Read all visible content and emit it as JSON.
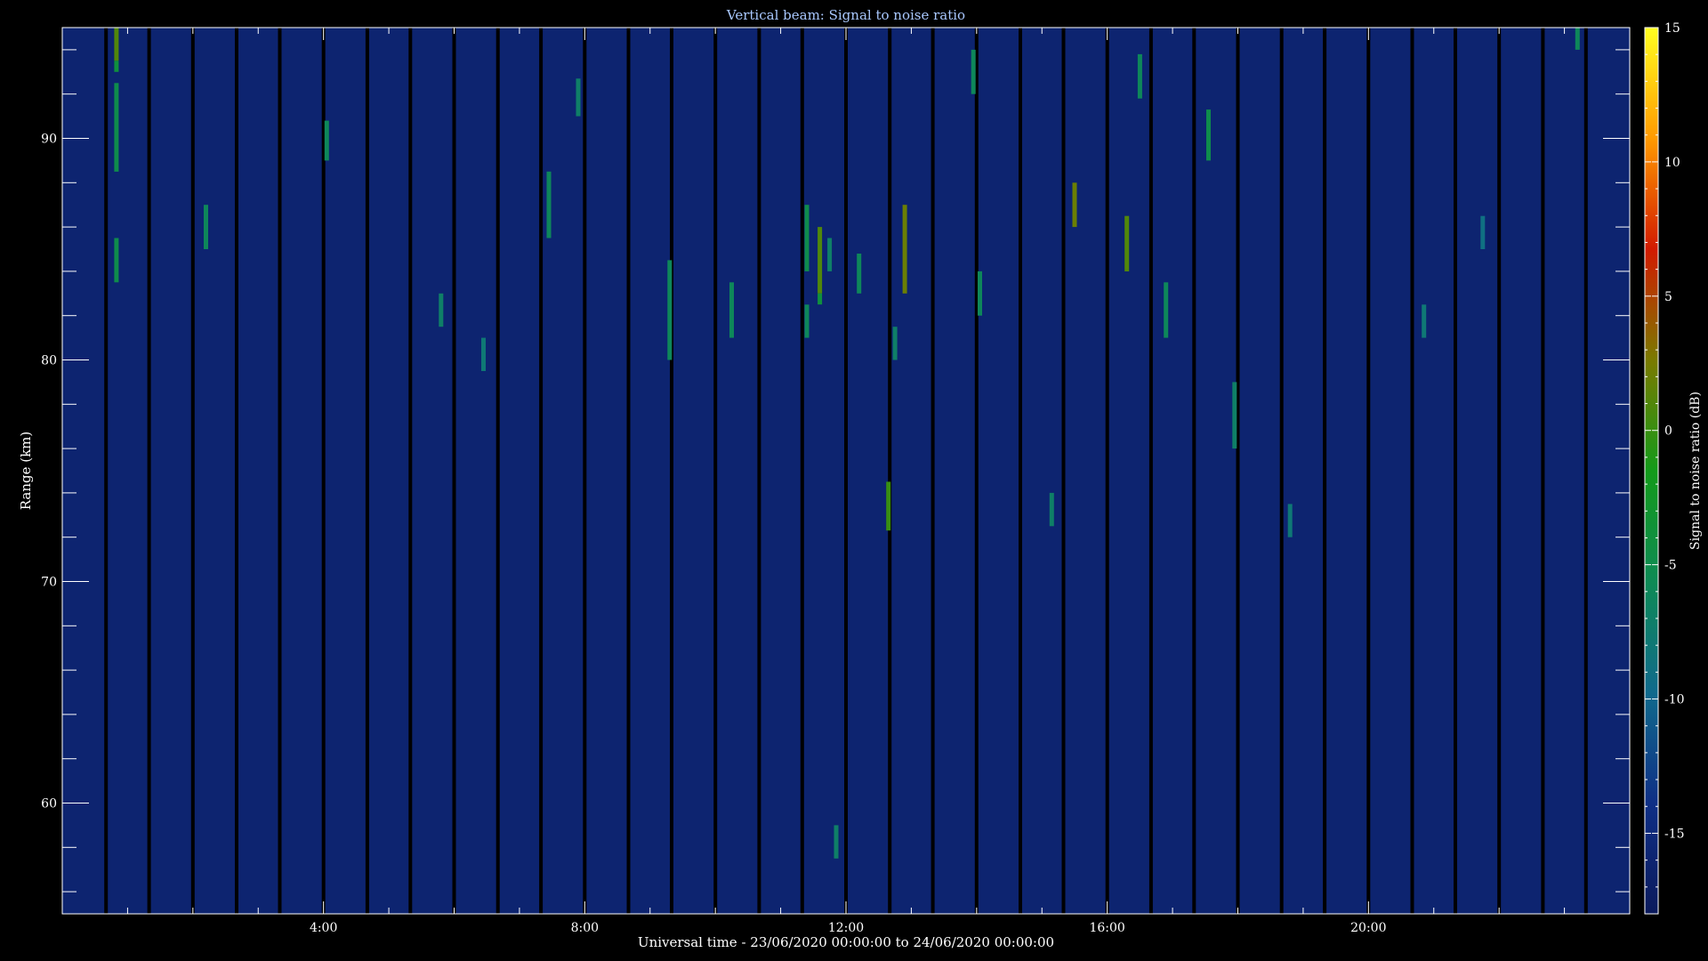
{
  "chart_data": {
    "type": "heatmap",
    "title": "Vertical beam: Signal to noise ratio",
    "xlabel": "Universal time - 23/06/2020 00:00:00 to 24/06/2020 00:00:00",
    "ylabel": "Range (km)",
    "colorbar_label": "Signal to noise ratio (dB)",
    "x_unit": "hours UT",
    "xlim": [
      0,
      24
    ],
    "ylim": [
      55,
      95
    ],
    "clim": [
      -18,
      15
    ],
    "x_ticks": [
      {
        "value": 4,
        "label": "4:00"
      },
      {
        "value": 8,
        "label": "8:00"
      },
      {
        "value": 12,
        "label": "12:00"
      },
      {
        "value": 16,
        "label": "16:00"
      },
      {
        "value": 20,
        "label": "20:00"
      }
    ],
    "y_ticks": [
      {
        "value": 60,
        "label": "60"
      },
      {
        "value": 70,
        "label": "70"
      },
      {
        "value": 80,
        "label": "80"
      },
      {
        "value": 90,
        "label": "90"
      }
    ],
    "colorbar_ticks": [
      {
        "value": 15,
        "label": "15"
      },
      {
        "value": 10,
        "label": "10"
      },
      {
        "value": 5,
        "label": "5"
      },
      {
        "value": 0,
        "label": "0"
      },
      {
        "value": -5,
        "label": "-5"
      },
      {
        "value": -10,
        "label": "-10"
      },
      {
        "value": -15,
        "label": "-15"
      }
    ],
    "colormap": [
      "#0b1a5c",
      "#0f2f86",
      "#106a8c",
      "#0e8a55",
      "#139a1a",
      "#7a7a00",
      "#d21a00",
      "#ff9a00",
      "#ffff20"
    ],
    "background_snr": -16,
    "data_gaps_hours": [
      0.67,
      1.33,
      2.0,
      2.67,
      3.33,
      4.0,
      4.67,
      5.33,
      6.0,
      6.67,
      7.33,
      8.0,
      8.67,
      9.33,
      10.0,
      10.67,
      11.33,
      12.0,
      12.67,
      13.33,
      14.0,
      14.67,
      15.33,
      16.0,
      16.67,
      17.33,
      18.0,
      18.67,
      19.33,
      20.0,
      20.67,
      21.33,
      22.0,
      22.67,
      23.33
    ],
    "echoes": [
      {
        "x": 0.83,
        "y0": 93.5,
        "y1": 95.0,
        "snr": 1
      },
      {
        "x": 0.83,
        "y0": 93.0,
        "y1": 93.5,
        "snr": -4
      },
      {
        "x": 0.83,
        "y0": 88.5,
        "y1": 92.5,
        "snr": -5
      },
      {
        "x": 0.83,
        "y0": 83.5,
        "y1": 85.5,
        "snr": -5
      },
      {
        "x": 2.2,
        "y0": 85.0,
        "y1": 87.0,
        "snr": -6
      },
      {
        "x": 4.05,
        "y0": 89.0,
        "y1": 90.8,
        "snr": -6
      },
      {
        "x": 5.8,
        "y0": 81.5,
        "y1": 83.0,
        "snr": -7
      },
      {
        "x": 6.45,
        "y0": 79.5,
        "y1": 81.0,
        "snr": -8
      },
      {
        "x": 7.45,
        "y0": 85.5,
        "y1": 88.5,
        "snr": -6
      },
      {
        "x": 7.9,
        "y0": 91.0,
        "y1": 92.7,
        "snr": -7
      },
      {
        "x": 9.3,
        "y0": 80.0,
        "y1": 84.5,
        "snr": -6
      },
      {
        "x": 10.25,
        "y0": 81.0,
        "y1": 83.5,
        "snr": -6
      },
      {
        "x": 11.4,
        "y0": 84.0,
        "y1": 87.0,
        "snr": -5
      },
      {
        "x": 11.4,
        "y0": 81.0,
        "y1": 82.5,
        "snr": -6
      },
      {
        "x": 11.6,
        "y0": 83.0,
        "y1": 86.0,
        "snr": 1
      },
      {
        "x": 11.6,
        "y0": 82.5,
        "y1": 83.0,
        "snr": -4
      },
      {
        "x": 11.75,
        "y0": 84.0,
        "y1": 85.5,
        "snr": -7
      },
      {
        "x": 11.85,
        "y0": 57.5,
        "y1": 59.0,
        "snr": -7
      },
      {
        "x": 12.2,
        "y0": 83.0,
        "y1": 84.8,
        "snr": -6
      },
      {
        "x": 12.65,
        "y0": 72.3,
        "y1": 74.5,
        "snr": 0
      },
      {
        "x": 12.75,
        "y0": 80.0,
        "y1": 81.5,
        "snr": -7
      },
      {
        "x": 12.9,
        "y0": 83.0,
        "y1": 87.0,
        "snr": 2
      },
      {
        "x": 13.95,
        "y0": 92.0,
        "y1": 94.0,
        "snr": -6
      },
      {
        "x": 14.05,
        "y0": 82.0,
        "y1": 84.0,
        "snr": -6
      },
      {
        "x": 15.15,
        "y0": 72.5,
        "y1": 74.0,
        "snr": -7
      },
      {
        "x": 15.5,
        "y0": 86.0,
        "y1": 88.0,
        "snr": 2
      },
      {
        "x": 16.3,
        "y0": 84.0,
        "y1": 86.5,
        "snr": 1
      },
      {
        "x": 16.5,
        "y0": 91.8,
        "y1": 93.8,
        "snr": -6
      },
      {
        "x": 16.9,
        "y0": 81.0,
        "y1": 83.5,
        "snr": -6
      },
      {
        "x": 17.55,
        "y0": 89.0,
        "y1": 91.3,
        "snr": -5
      },
      {
        "x": 17.95,
        "y0": 76.0,
        "y1": 79.0,
        "snr": -7
      },
      {
        "x": 18.8,
        "y0": 72.0,
        "y1": 73.5,
        "snr": -8
      },
      {
        "x": 20.85,
        "y0": 81.0,
        "y1": 82.5,
        "snr": -8
      },
      {
        "x": 21.75,
        "y0": 85.0,
        "y1": 86.5,
        "snr": -9
      },
      {
        "x": 23.2,
        "y0": 94.0,
        "y1": 95.0,
        "snr": -6
      }
    ]
  }
}
